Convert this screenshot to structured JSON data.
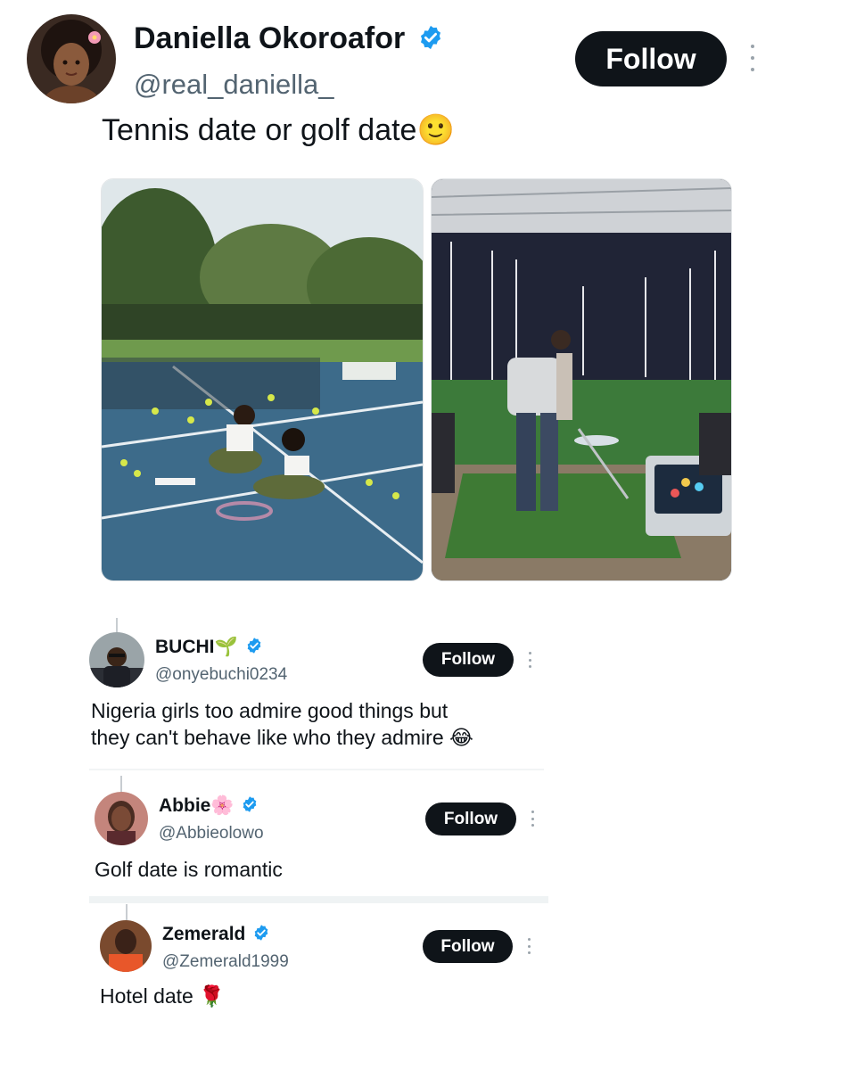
{
  "main_post": {
    "author_name": "Daniella Okoroafor",
    "author_handle": "@real_daniella_",
    "text": "Tennis date or golf date",
    "emoji": "🙂",
    "follow_label": "Follow",
    "images": [
      "tennis-court-photo",
      "golf-range-photo"
    ]
  },
  "replies": [
    {
      "name": "BUCHI",
      "name_emoji": "🌱",
      "handle": "@onyebuchi0234",
      "follow_label": "Follow",
      "text_line1": "Nigeria girls too admire good things but",
      "text_line2": "they can't behave like who they admire",
      "text_emoji": "😂"
    },
    {
      "name": "Abbie",
      "name_emoji": "🌸",
      "handle": "@Abbieolowo",
      "follow_label": "Follow",
      "text": "Golf date is romantic"
    },
    {
      "name": "Zemerald",
      "handle": "@Zemerald1999",
      "follow_label": "Follow",
      "text": "Hotel date",
      "text_emoji": "🌹"
    }
  ],
  "colors": {
    "verified": "#1d9bf0",
    "follow_bg": "#0f1419",
    "handle": "#536471"
  },
  "icons": [
    "verified-badge-icon",
    "more-options-icon"
  ]
}
